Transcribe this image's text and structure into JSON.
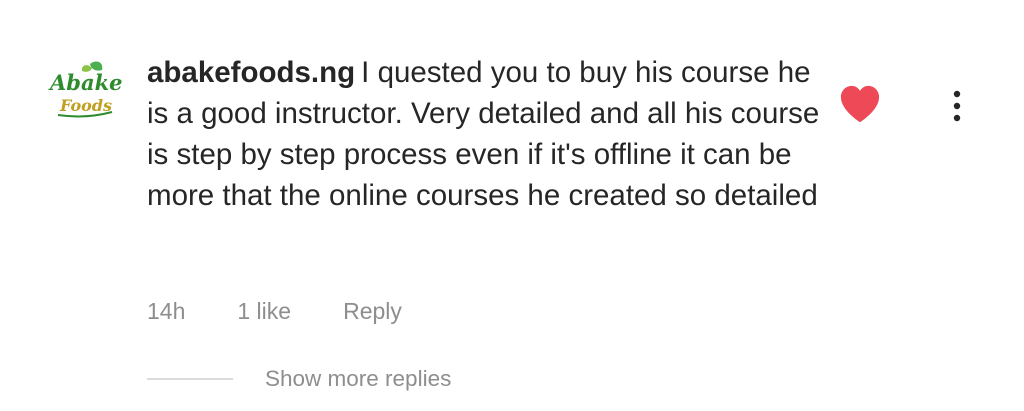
{
  "comment": {
    "avatar": {
      "brand_line1": "Abake",
      "brand_line2": "Foods",
      "icon": "abake-foods-logo",
      "colors": {
        "text": "#2e8b2e",
        "leaf": "#4caf50",
        "accent": "#8bc34a"
      }
    },
    "username": "abakefoods.ng",
    "text": "I quested you to buy his course he is a good instructor. Very detailed and all his course is step by step process even if it's offline it can be more that the online courses he created so detailed",
    "meta": {
      "time": "14h",
      "likes": "1 like",
      "reply": "Reply"
    },
    "liked": true,
    "like_icon": "heart-icon",
    "like_color": "#ed4956",
    "menu_icon": "more-vertical-icon",
    "replies": {
      "label": "Show more replies"
    }
  }
}
